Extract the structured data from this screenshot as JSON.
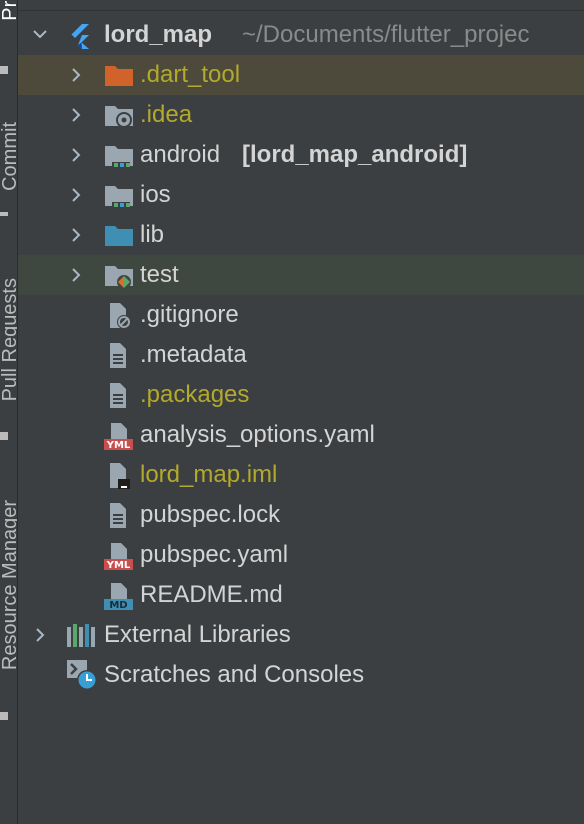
{
  "side_panel": {
    "tabs": [
      "Proje",
      "Commit",
      "Pull Requests",
      "Resource Manager"
    ]
  },
  "colors": {
    "background": "#3c3f41",
    "excluded_row": "#4d4a3b",
    "tests_row": "#3f4741",
    "olive_text": "#b3a92a",
    "folder_blue": "#3f8fb5",
    "folder_gray": "#9aa7b0",
    "folder_orange": "#d0622a"
  },
  "tree": {
    "root": {
      "name": "lord_map",
      "path": "~/Documents/flutter_projec",
      "icon": "flutter-icon"
    },
    "items": [
      {
        "label": ".dart_tool",
        "icon": "folder-excluded-icon",
        "expandable": true,
        "style": "excluded"
      },
      {
        "label": ".idea",
        "icon": "folder-settings-icon",
        "expandable": true,
        "style": "olive"
      },
      {
        "label": "android",
        "module": "[lord_map_android]",
        "icon": "folder-module-icon",
        "expandable": true
      },
      {
        "label": "ios",
        "icon": "folder-module-icon",
        "expandable": true
      },
      {
        "label": "lib",
        "icon": "folder-source-icon",
        "expandable": true
      },
      {
        "label": "test",
        "icon": "folder-test-icon",
        "expandable": true,
        "style": "tests"
      },
      {
        "label": ".gitignore",
        "icon": "file-ignore-icon"
      },
      {
        "label": ".metadata",
        "icon": "file-text-icon"
      },
      {
        "label": ".packages",
        "icon": "file-text-icon",
        "style": "olive"
      },
      {
        "label": "analysis_options.yaml",
        "icon": "file-yaml-icon"
      },
      {
        "label": "lord_map.iml",
        "icon": "file-iml-icon",
        "style": "olive"
      },
      {
        "label": "pubspec.lock",
        "icon": "file-text-icon"
      },
      {
        "label": "pubspec.yaml",
        "icon": "file-yaml-icon"
      },
      {
        "label": "README.md",
        "icon": "file-markdown-icon"
      }
    ],
    "external_libraries": "External Libraries",
    "scratches": "Scratches and Consoles",
    "yaml_badge": "YML",
    "md_badge": "MD"
  }
}
